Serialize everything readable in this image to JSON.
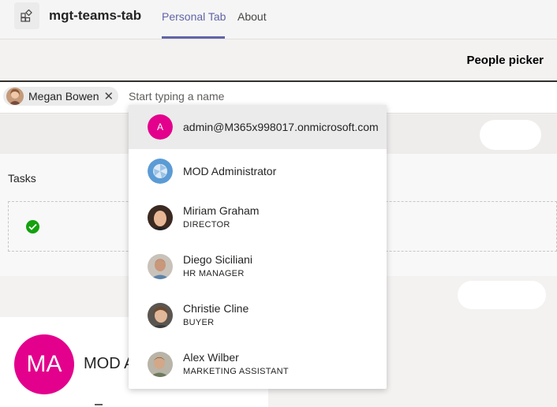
{
  "header": {
    "app_title": "mgt-teams-tab",
    "tabs": [
      {
        "label": "Personal Tab",
        "active": true
      },
      {
        "label": "About",
        "active": false
      }
    ]
  },
  "page": {
    "heading": "People picker",
    "selected_person": {
      "name": "Megan Bowen",
      "remove_icon": "close-icon"
    },
    "search": {
      "value": "",
      "placeholder": "Start typing a name"
    },
    "tasks_label": "Tasks",
    "card": {
      "initials": "MA",
      "name_visible": "MOD A"
    }
  },
  "dropdown": {
    "items": [
      {
        "name": "admin@M365x998017.onmicrosoft.com",
        "subtitle": "",
        "initial": "A",
        "selected": true
      },
      {
        "name": "MOD Administrator",
        "subtitle": ""
      },
      {
        "name": "Miriam Graham",
        "subtitle": "DIRECTOR"
      },
      {
        "name": "Diego Siciliani",
        "subtitle": "HR MANAGER"
      },
      {
        "name": "Christie Cline",
        "subtitle": "BUYER"
      },
      {
        "name": "Alex Wilber",
        "subtitle": "MARKETING ASSISTANT"
      }
    ]
  },
  "colors": {
    "accent": "#6264a7",
    "initial_avatar": "#e3008c",
    "task_check": "#13a10e"
  }
}
